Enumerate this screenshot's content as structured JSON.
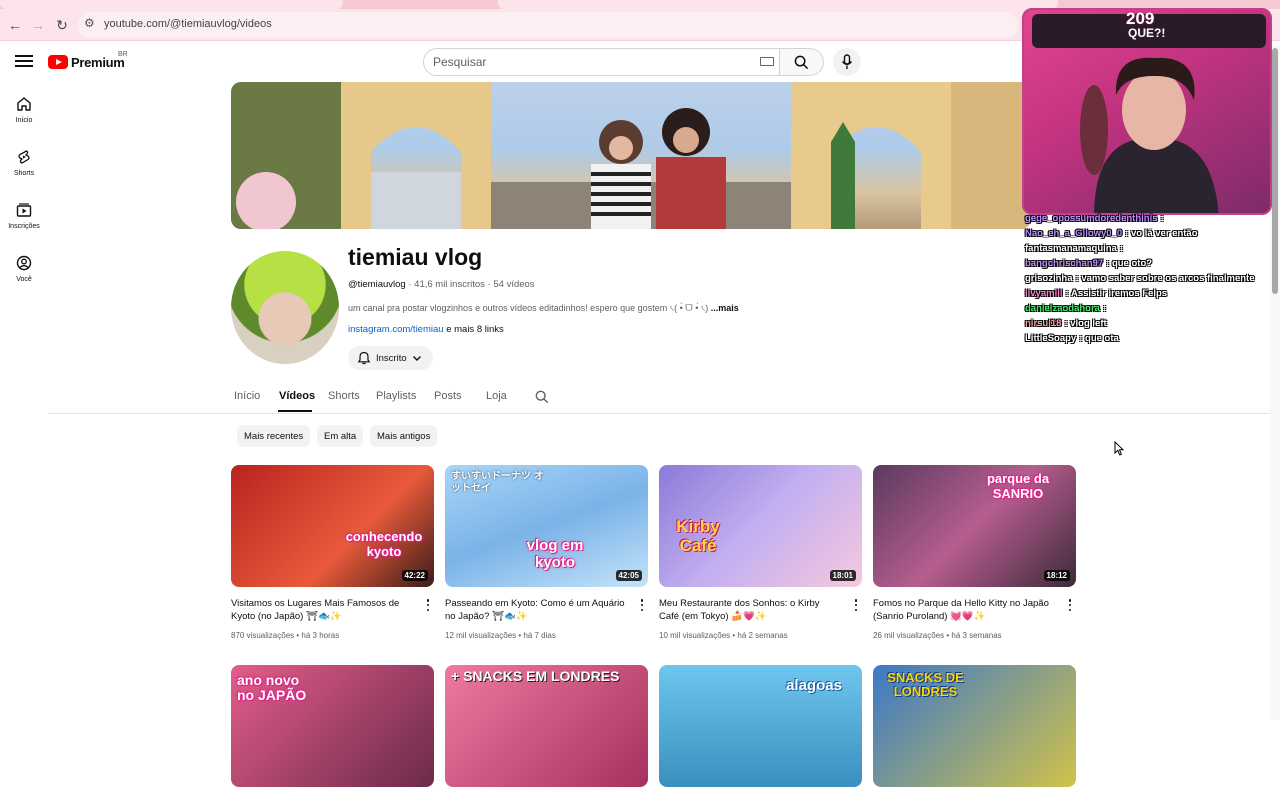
{
  "browser": {
    "url": "youtube.com/@tiemiauvlog/videos"
  },
  "masthead": {
    "logo_text": "Premium",
    "logo_country": "BR",
    "search_placeholder": "Pesquisar"
  },
  "guide": [
    {
      "label": "Início",
      "icon": "home-icon"
    },
    {
      "label": "Shorts",
      "icon": "shorts-icon"
    },
    {
      "label": "Inscrições",
      "icon": "subscriptions-icon"
    },
    {
      "label": "Você",
      "icon": "you-icon"
    }
  ],
  "channel": {
    "name": "tiemiau vlog",
    "handle": "@tiemiauvlog",
    "subscribers": "41,6 mil inscritos",
    "videos_count": "54 vídeos",
    "description": "um canal pra postar vlogzinhos e outros vídeos editadinhos! espero que gostem ৻(  •̀ ᗜ •́  ৻)",
    "more_label": "...mais",
    "link": "instagram.com/tiemiau",
    "more_links": "e mais 8 links",
    "subscribe_label": "Inscrito"
  },
  "tabs": [
    "Início",
    "Vídeos",
    "Shorts",
    "Playlists",
    "Posts",
    "Loja"
  ],
  "active_tab": "Vídeos",
  "chips": [
    "Mais recentes",
    "Em alta",
    "Mais antigos"
  ],
  "videos": [
    {
      "title": "Visitamos os Lugares Mais Famosos de Kyoto (no Japão) ⛩🐟✨",
      "views": "870 visualizações",
      "age": "há 3 horas",
      "duration": "42:22",
      "caption": "conhecendo kyoto",
      "color": "#c9322d"
    },
    {
      "title": "Passeando em Kyoto: Como é um Aquário no Japão? ⛩🐟✨",
      "views": "12 mil visualizações",
      "age": "há 7 dias",
      "duration": "42:05",
      "caption": "vlog em kyoto",
      "top_caption": "すいすいドーナツ オットセイ",
      "color": "#7bb3e8"
    },
    {
      "title": "Meu Restaurante dos Sonhos: o Kirby Café (em Tokyo) 🍰💗✨",
      "views": "10 mil visualizações",
      "age": "há 2 semanas",
      "duration": "18:01",
      "caption": "Kirby Café",
      "color": "#a58ee0"
    },
    {
      "title": "Fomos no Parque da Hello Kitty no Japão (Sanrio Puroland) 💓💗✨",
      "views": "26 mil visualizações",
      "age": "há 3 semanas",
      "duration": "18:12",
      "caption": "parque da SANRIO",
      "color": "#8a4a7a"
    }
  ],
  "videos_row2": [
    {
      "caption": "ano novo no JAPÃO",
      "color": "#d64a7a"
    },
    {
      "caption": "+ SNACKS EM LONDRES",
      "color": "#d4537f"
    },
    {
      "caption": "alagoas",
      "color": "#4ea6cf"
    },
    {
      "caption": "SNACKS DE LONDRES",
      "color": "#2e6cb5"
    }
  ],
  "overlay": {
    "label_top": "209",
    "label_bottom": "QUE?!",
    "chat": [
      {
        "user": "gege_opossumdoredenthinis",
        "msg": "",
        "color": "#b98cff"
      },
      {
        "user": "Nao_eh_a_Gilowy0_0",
        "msg": "vo lá ver então",
        "color": "#b98cff"
      },
      {
        "user": "fantasmanamaquina",
        "msg": "",
        "color": "#ffffff"
      },
      {
        "user": "bangchrischan97",
        "msg": "que oto?",
        "color": "#b98cff"
      },
      {
        "user": "grisozinha",
        "msg": "vamo saber sobre os arcos finalmente",
        "color": "#ffffff"
      },
      {
        "user": "livyamill",
        "msg": "Assistir iremos Felps",
        "color": "#ff7bd0"
      },
      {
        "user": "danielzaodahora",
        "msg": "",
        "color": "#3ce86a"
      },
      {
        "user": "nirsul18",
        "msg": "vlog left",
        "color": "#ff9aa0"
      },
      {
        "user": "LittleSoapy",
        "msg": "que ota",
        "color": "#ffffff"
      }
    ]
  }
}
